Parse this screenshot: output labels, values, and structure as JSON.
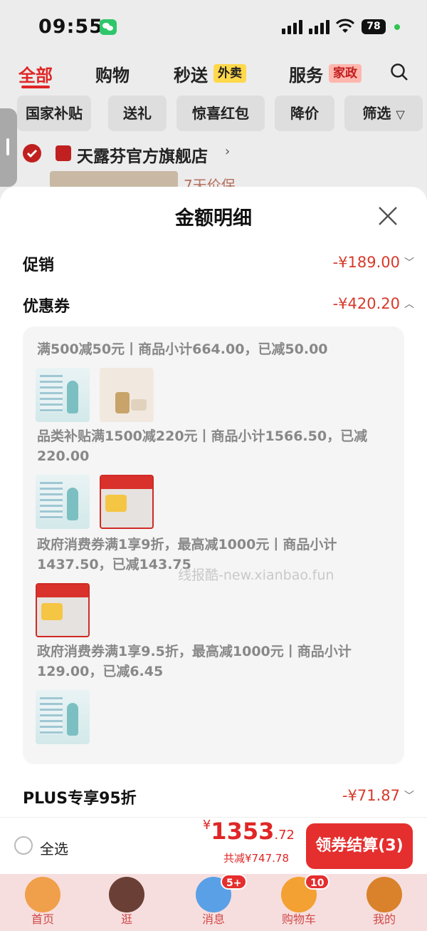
{
  "status": {
    "time": "09:55",
    "battery": "78"
  },
  "nav": {
    "tabs": [
      {
        "label": "全部"
      },
      {
        "label": "购物"
      },
      {
        "label": "秒送",
        "tag": "外卖"
      },
      {
        "label": "服务",
        "tag": "家政"
      }
    ]
  },
  "filters": [
    "国家补贴",
    "送礼",
    "惊喜红包",
    "降价",
    "筛选"
  ],
  "store": {
    "name": "天露芬官方旗舰店",
    "peek_text": "7天价保"
  },
  "sheet": {
    "title": "金额明细",
    "promo": {
      "label": "促销",
      "amount": "-¥189.00"
    },
    "coupon": {
      "label": "优惠券",
      "amount": "-¥420.20"
    },
    "coupon_items": [
      {
        "text": "满500减50元丨商品小计664.00，已减50.00"
      },
      {
        "text": "品类补贴满1500减220元丨商品小计1566.50，已减220.00"
      },
      {
        "text": "政府消费券满1享9折，最高减1000元丨商品小计1437.50，已减143.75"
      },
      {
        "text": "政府消费券满1享9.5折，最高减1000元丨商品小计129.00，已减6.45"
      }
    ],
    "plus": {
      "label": "PLUS专享95折",
      "amount": "-¥71.87"
    },
    "watermark": "线报酷-new.xianbao.fun"
  },
  "checkout": {
    "select_all": "全选",
    "currency": "¥",
    "total_int": "1353",
    "total_dec": ".72",
    "saved": "共减¥747.78",
    "button": "领券结算(3)"
  },
  "tabbar": [
    {
      "label": "首页"
    },
    {
      "label": "逛"
    },
    {
      "label": "消息",
      "badge": "5+"
    },
    {
      "label": "购物车",
      "badge": "10"
    },
    {
      "label": "我的"
    }
  ],
  "colors": {
    "accent": "#e02626",
    "sheet_bg": "#ffffff",
    "overlay": "#ececec"
  }
}
